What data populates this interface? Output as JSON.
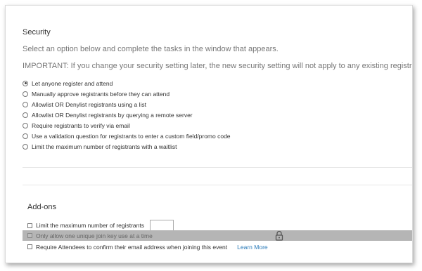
{
  "security": {
    "title": "Security",
    "subtitle": "Select an option below and complete the tasks in the window that appears.",
    "important": "IMPORTANT:  If you change your security setting later, the new security setting will not apply to any existing registrants.",
    "options": [
      {
        "label": "Let anyone register and attend",
        "checked": true
      },
      {
        "label": "Manually approve registrants before they can attend",
        "checked": false
      },
      {
        "label": "Allowlist OR Denylist registrants using a list",
        "checked": false
      },
      {
        "label": "Allowlist OR Denylist registrants by querying a remote server",
        "checked": false
      },
      {
        "label": "Require registrants to verify via email",
        "checked": false
      },
      {
        "label": "Use a validation question for registrants to enter a custom field/promo code",
        "checked": false
      },
      {
        "label": "Limit the maximum number of registrants with a waitlist",
        "checked": false
      }
    ]
  },
  "addons": {
    "title": "Add-ons",
    "max_registrants": {
      "label": "Limit the maximum number of registrants",
      "value": ""
    },
    "unique_join_key": {
      "label": "Only allow one unique join key use at a time",
      "icon": "lock-icon"
    },
    "confirm_email": {
      "label": "Require Attendees to confirm their email address when joining this event",
      "link": "Learn More"
    }
  },
  "colors": {
    "link": "#2a7ab8",
    "disabled_row": "#b5b5b5"
  }
}
